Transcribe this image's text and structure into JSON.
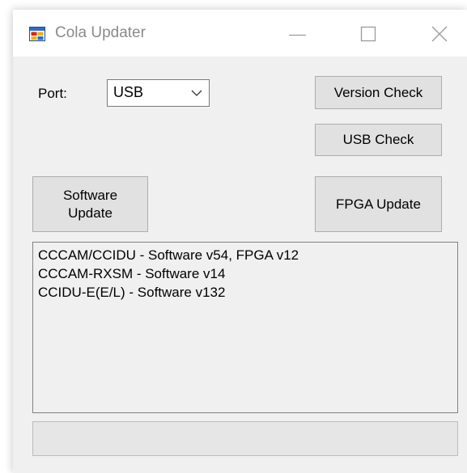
{
  "window": {
    "title": "Cola Updater"
  },
  "port": {
    "label": "Port:",
    "selected": "USB"
  },
  "buttons": {
    "version_check": "Version Check",
    "usb_check": "USB Check",
    "software_update": "Software Update",
    "fpga_update": "FPGA Update"
  },
  "versions": {
    "lines": [
      "CCCAM/CCIDU - Software v54, FPGA v12",
      "CCCAM-RXSM - Software v14",
      "CCIDU-E(E/L) - Software v132"
    ]
  },
  "progress": {
    "value": 0
  },
  "icons": {
    "app": "window-app-icon",
    "minimize": "minimize-icon",
    "maximize": "maximize-icon",
    "close": "close-icon",
    "dropdown": "chevron-down-icon"
  },
  "colors": {
    "window_bg": "#f0f0f0",
    "button_bg": "#e1e1e1",
    "progress_fill": "#06b025"
  }
}
